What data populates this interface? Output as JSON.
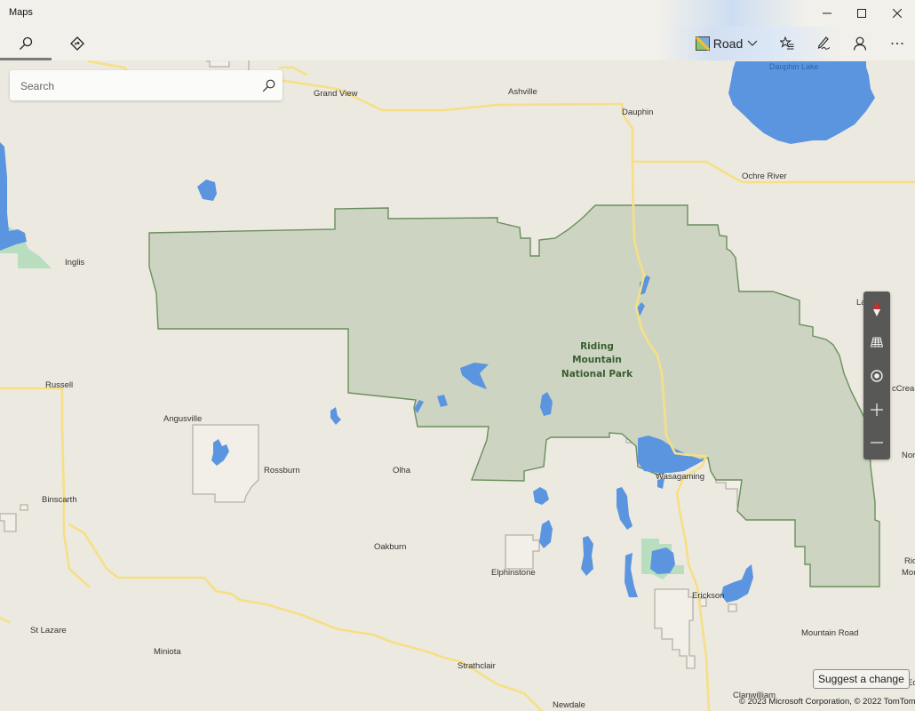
{
  "window": {
    "title": "Maps",
    "minimize_icon": "minimize-icon",
    "maximize_icon": "maximize-icon",
    "close_icon": "close-icon"
  },
  "toolbar": {
    "tabs": [
      {
        "name": "search",
        "icon": "search-icon",
        "active": true
      },
      {
        "name": "directions",
        "icon": "directions-icon",
        "active": false
      }
    ],
    "map_style": {
      "label": "Road",
      "icon": "road-map-icon"
    },
    "buttons": [
      {
        "name": "favorites",
        "icon": "favorites-list-icon"
      },
      {
        "name": "ink",
        "icon": "pen-icon"
      },
      {
        "name": "account",
        "icon": "person-icon"
      },
      {
        "name": "more",
        "icon": "more-icon"
      }
    ]
  },
  "search": {
    "placeholder": "Search",
    "value": ""
  },
  "map": {
    "colors": {
      "land": "#ece9e0",
      "park_fill": "#cdd5c2",
      "park_border": "#6a8e5c",
      "water": "#5b95e0",
      "road": "#f6df86",
      "reserve_fill": "#a7d9b4",
      "town_boundary": "#b7b1a6"
    },
    "park_label": [
      "Riding",
      "Mountain",
      "National Park"
    ],
    "lake_labels": [
      "Dauphin Lake"
    ],
    "places": [
      {
        "name": "Grand View"
      },
      {
        "name": "Ashville"
      },
      {
        "name": "Dauphin"
      },
      {
        "name": "Ochre River"
      },
      {
        "name": "Inglis"
      },
      {
        "name": "Russell"
      },
      {
        "name": "Angusville"
      },
      {
        "name": "Rossburn"
      },
      {
        "name": "Olha"
      },
      {
        "name": "Binscarth"
      },
      {
        "name": "Wasagaming"
      },
      {
        "name": "Oakburn"
      },
      {
        "name": "Elphinstone"
      },
      {
        "name": "Erickson"
      },
      {
        "name": "St Lazare"
      },
      {
        "name": "Miniota"
      },
      {
        "name": "Strathclair"
      },
      {
        "name": "Newdale"
      },
      {
        "name": "Clanwilliam"
      },
      {
        "name": "Mountain Road"
      },
      {
        "name": "La"
      },
      {
        "name": "cCrean"
      },
      {
        "name": "Nor"
      },
      {
        "name": "Rid"
      },
      {
        "name": "Mou"
      },
      {
        "name": "Ed"
      }
    ]
  },
  "map_controls": [
    {
      "name": "compass",
      "icon": "compass-icon"
    },
    {
      "name": "tilt",
      "icon": "tilt-grid-icon"
    },
    {
      "name": "my-location",
      "icon": "location-icon"
    },
    {
      "name": "zoom-in",
      "icon": "plus-icon"
    },
    {
      "name": "zoom-out",
      "icon": "minus-icon"
    }
  ],
  "footer": {
    "suggest_label": "Suggest a change",
    "copyright": "© 2023 Microsoft Corporation, © 2022 TomTom"
  }
}
